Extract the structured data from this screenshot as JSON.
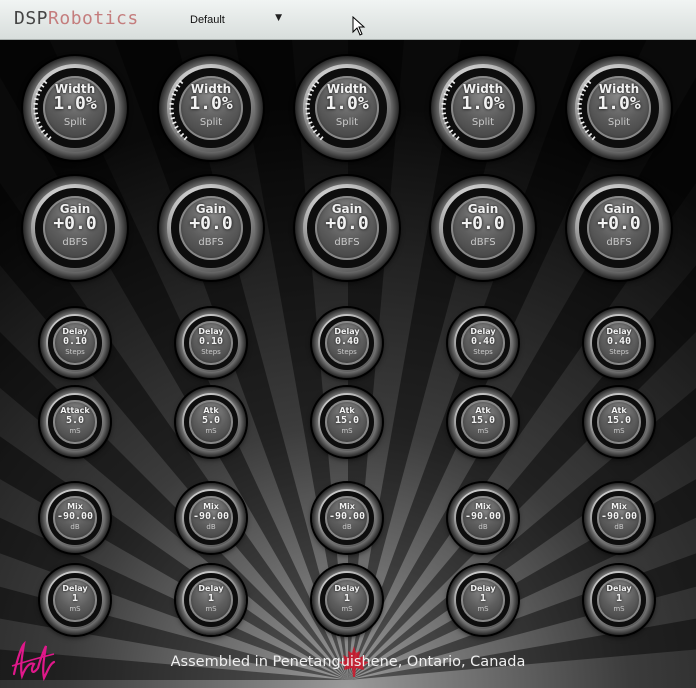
{
  "header": {
    "brand_part1": "DSP",
    "brand_part2": "Robotics",
    "preset_value": "Default",
    "dropdown_arrow": "▼"
  },
  "colors": {
    "brand_dark": "#444444",
    "brand_accent": "#c47d7d",
    "background": "#000000",
    "maple_leaf": "#d0152a",
    "signature": "#e0188a"
  },
  "rows": [
    {
      "name": "width",
      "knobs": [
        {
          "label": "Width",
          "value": "1.0%",
          "unit": "Split"
        },
        {
          "label": "Width",
          "value": "1.0%",
          "unit": "Split"
        },
        {
          "label": "Width",
          "value": "1.0%",
          "unit": "Split"
        },
        {
          "label": "Width",
          "value": "1.0%",
          "unit": "Split"
        },
        {
          "label": "Width",
          "value": "1.0%",
          "unit": "Split"
        }
      ]
    },
    {
      "name": "gain",
      "knobs": [
        {
          "label": "Gain",
          "value": "+0.0",
          "unit": "dBFS"
        },
        {
          "label": "Gain",
          "value": "+0.0",
          "unit": "dBFS"
        },
        {
          "label": "Gain",
          "value": "+0.0",
          "unit": "dBFS"
        },
        {
          "label": "Gain",
          "value": "+0.0",
          "unit": "dBFS"
        },
        {
          "label": "Gain",
          "value": "+0.0",
          "unit": "dBFS"
        }
      ]
    },
    {
      "name": "delay-steps",
      "knobs": [
        {
          "label": "Delay",
          "value": "0.10",
          "unit": "Steps"
        },
        {
          "label": "Delay",
          "value": "0.10",
          "unit": "Steps"
        },
        {
          "label": "Delay",
          "value": "0.40",
          "unit": "Steps"
        },
        {
          "label": "Delay",
          "value": "0.40",
          "unit": "Steps"
        },
        {
          "label": "Delay",
          "value": "0.40",
          "unit": "Steps"
        }
      ]
    },
    {
      "name": "attack",
      "knobs": [
        {
          "label": "Attack",
          "value": "5.0",
          "unit": "mS"
        },
        {
          "label": "Atk",
          "value": "5.0",
          "unit": "mS"
        },
        {
          "label": "Atk",
          "value": "15.0",
          "unit": "mS"
        },
        {
          "label": "Atk",
          "value": "15.0",
          "unit": "mS"
        },
        {
          "label": "Atk",
          "value": "15.0",
          "unit": "mS"
        }
      ]
    },
    {
      "name": "mix",
      "knobs": [
        {
          "label": "Mix",
          "value": "-90.00",
          "unit": "dB"
        },
        {
          "label": "Mix",
          "value": "-90.00",
          "unit": "dB"
        },
        {
          "label": "Mix",
          "value": "-90.00",
          "unit": "dB"
        },
        {
          "label": "Mix",
          "value": "-90.00",
          "unit": "dB"
        },
        {
          "label": "Mix",
          "value": "-90.00",
          "unit": "dB"
        }
      ]
    },
    {
      "name": "delay-ms",
      "knobs": [
        {
          "label": "Delay",
          "value": "1",
          "unit": "mS"
        },
        {
          "label": "Delay",
          "value": "1",
          "unit": "mS"
        },
        {
          "label": "Delay",
          "value": "1",
          "unit": "mS"
        },
        {
          "label": "Delay",
          "value": "1",
          "unit": "mS"
        },
        {
          "label": "Delay",
          "value": "1",
          "unit": "mS"
        }
      ]
    }
  ],
  "footer": {
    "text": "Assembled in Penetanguishene, Ontario, Canada",
    "leaf_icon": "maple-leaf-icon",
    "signature_icon": "signature-icon"
  }
}
